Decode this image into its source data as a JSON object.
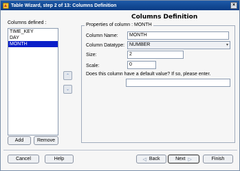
{
  "window": {
    "title": "Table Wizard, step 2 of 13: Columns Definition",
    "close_glyph": "×"
  },
  "page": {
    "heading": "Columns Definition"
  },
  "columns_list": {
    "label": "Columns defined :",
    "items": [
      "TIME_KEY",
      "DAY",
      "MONTH"
    ],
    "selected": "MONTH"
  },
  "list_buttons": {
    "add": "Add",
    "remove": "Remove"
  },
  "move_buttons": {
    "up_glyph": "⌃",
    "down_glyph": "⌄"
  },
  "properties": {
    "group_label": "Properties of column : MONTH",
    "column_name_label": "Column Name:",
    "column_name_value": "MONTH",
    "datatype_label": "Column Datatype:",
    "datatype_value": "NUMBER",
    "size_label": "Size:",
    "size_value": "2",
    "scale_label": "Scale:",
    "scale_value": "0",
    "default_question": "Does this column have a default value? If so, please enter.",
    "default_value": ""
  },
  "footer": {
    "cancel": "Cancel",
    "help": "Help",
    "back": "Back",
    "next": "Next",
    "finish": "Finish",
    "back_glyph": "◁",
    "next_glyph": "▷"
  }
}
